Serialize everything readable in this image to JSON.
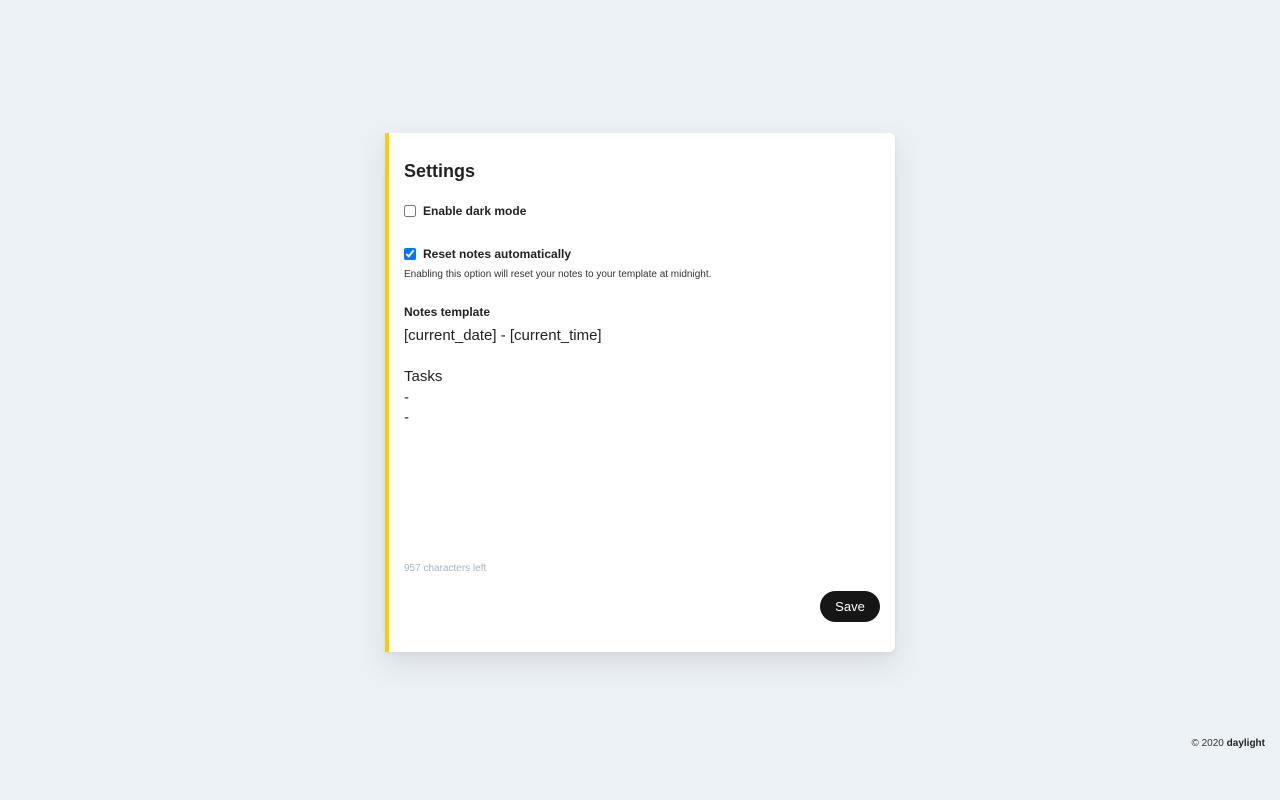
{
  "settings": {
    "title": "Settings",
    "dark_mode": {
      "label": "Enable dark mode",
      "checked": false
    },
    "reset_notes": {
      "label": "Reset notes automatically",
      "checked": true,
      "hint": "Enabling this option will reset your notes to your template at midnight."
    },
    "template": {
      "label": "Notes template",
      "value": "[current_date] - [current_time]\n\nTasks\n-\n-"
    },
    "chars_left": "957 characters left",
    "save_label": "Save"
  },
  "footer": {
    "copyright": "© 2020",
    "brand": "daylight"
  },
  "colors": {
    "accent": "#f5cf0a",
    "background": "#ecf1f5",
    "button": "#161616"
  }
}
